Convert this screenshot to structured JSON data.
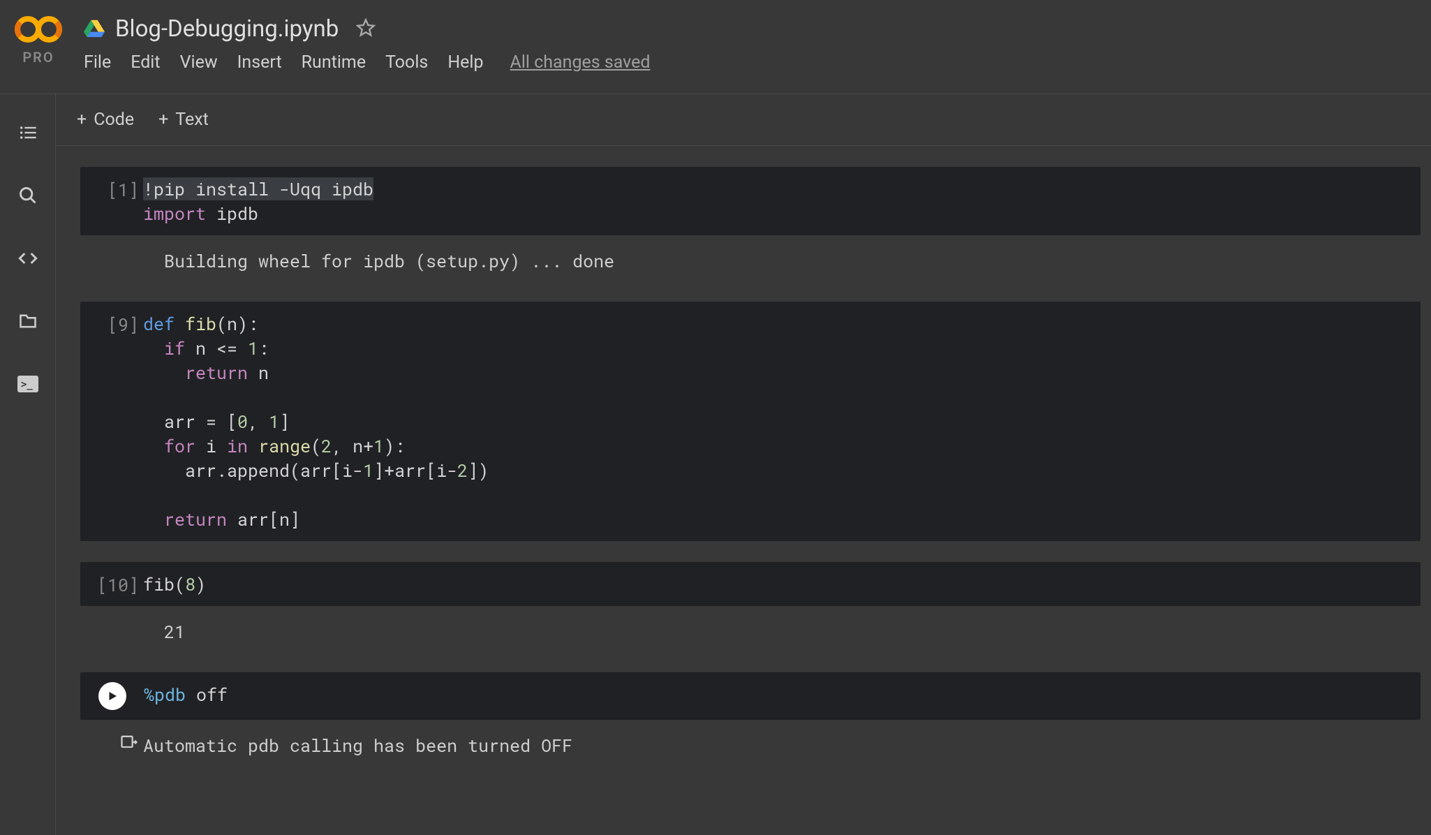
{
  "header": {
    "pro_label": "PRO",
    "notebook_title": "Blog-Debugging.ipynb",
    "menu": {
      "file": "File",
      "edit": "Edit",
      "view": "View",
      "insert": "Insert",
      "runtime": "Runtime",
      "tools": "Tools",
      "help": "Help"
    },
    "save_status": "All changes saved"
  },
  "toolbar": {
    "add_code": "Code",
    "add_text": "Text"
  },
  "cells": [
    {
      "exec": "[1]",
      "code_tokens": [
        {
          "cls": "hl-sel",
          "txt": "!pip install -Uqq ipdb"
        },
        {
          "cls": "",
          "txt": "\n"
        },
        {
          "cls": "kw2",
          "txt": "import"
        },
        {
          "cls": "",
          "txt": " ipdb"
        }
      ],
      "output": "Building wheel for ipdb (setup.py) ... done"
    },
    {
      "exec": "[9]",
      "code_tokens": [
        {
          "cls": "kw",
          "txt": "def"
        },
        {
          "cls": "",
          "txt": " "
        },
        {
          "cls": "fn",
          "txt": "fib"
        },
        {
          "cls": "",
          "txt": "(n):\n  "
        },
        {
          "cls": "kw2",
          "txt": "if"
        },
        {
          "cls": "",
          "txt": " n <= "
        },
        {
          "cls": "num",
          "txt": "1"
        },
        {
          "cls": "",
          "txt": ":\n    "
        },
        {
          "cls": "kw2",
          "txt": "return"
        },
        {
          "cls": "",
          "txt": " n\n\n  arr = ["
        },
        {
          "cls": "num",
          "txt": "0"
        },
        {
          "cls": "",
          "txt": ", "
        },
        {
          "cls": "num",
          "txt": "1"
        },
        {
          "cls": "",
          "txt": "]\n  "
        },
        {
          "cls": "kw2",
          "txt": "for"
        },
        {
          "cls": "",
          "txt": " i "
        },
        {
          "cls": "kw2",
          "txt": "in"
        },
        {
          "cls": "",
          "txt": " "
        },
        {
          "cls": "fn",
          "txt": "range"
        },
        {
          "cls": "",
          "txt": "("
        },
        {
          "cls": "num",
          "txt": "2"
        },
        {
          "cls": "",
          "txt": ", n+"
        },
        {
          "cls": "num",
          "txt": "1"
        },
        {
          "cls": "",
          "txt": "):\n    arr.append(arr[i-"
        },
        {
          "cls": "num",
          "txt": "1"
        },
        {
          "cls": "",
          "txt": "]+arr[i-"
        },
        {
          "cls": "num",
          "txt": "2"
        },
        {
          "cls": "",
          "txt": "])\n\n  "
        },
        {
          "cls": "kw2",
          "txt": "return"
        },
        {
          "cls": "",
          "txt": " arr[n]"
        }
      ]
    },
    {
      "exec": "[10]",
      "code_tokens": [
        {
          "cls": "",
          "txt": "fib("
        },
        {
          "cls": "num",
          "txt": "8"
        },
        {
          "cls": "",
          "txt": ")"
        }
      ],
      "output": "21"
    },
    {
      "exec": "",
      "running": true,
      "code_tokens": [
        {
          "cls": "mag",
          "txt": "%pdb"
        },
        {
          "cls": "",
          "txt": " off"
        }
      ],
      "output": "Automatic pdb calling has been turned OFF",
      "out_icon": true
    }
  ]
}
